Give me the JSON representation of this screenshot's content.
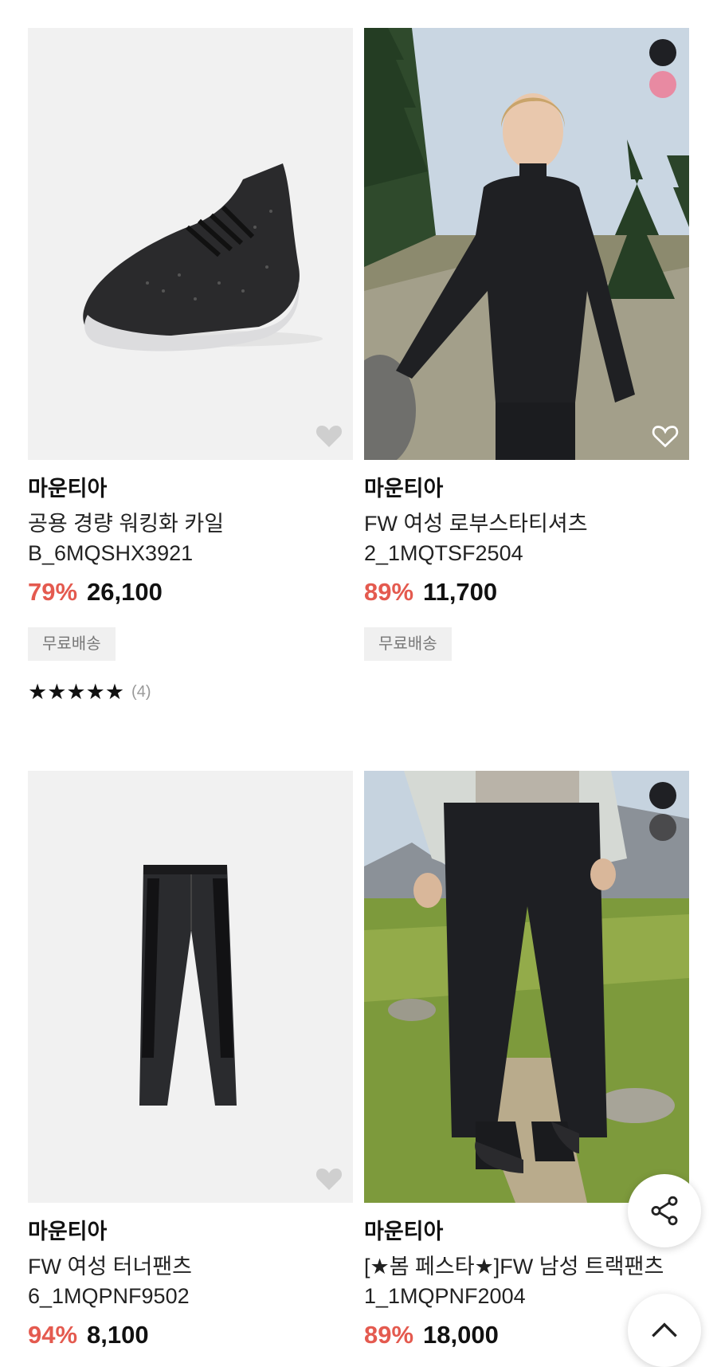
{
  "products": [
    {
      "brand": "마운티아",
      "title_line1": "공용 경량 워킹화 카일",
      "title_line2": "B_6MQSHX3921",
      "discount": "79%",
      "price": "26,100",
      "badge": "무료배송",
      "rating_stars": "★★★★★",
      "rating_count": "(4)",
      "image_icon": "sneaker-image",
      "heart_icon": "heart-icon"
    },
    {
      "brand": "마운티아",
      "title_line1": "FW 여성 로부스타티셔츠",
      "title_line2": "2_1MQTSF2504",
      "discount": "89%",
      "price": "11,700",
      "badge": "무료배송",
      "swatches": [
        "#1f2024",
        "#e88aa2"
      ],
      "image_icon": "woman-black-halfzip-photo",
      "heart_icon": "heart-outline-icon"
    },
    {
      "brand": "마운티아",
      "title_line1": "FW 여성 터너팬츠",
      "title_line2": "6_1MQPNF9502",
      "discount": "94%",
      "price": "8,100",
      "image_icon": "pants-image",
      "heart_icon": "heart-icon"
    },
    {
      "brand": "마운티아",
      "title_line1": "[★봄 페스타★]FW 남성 트랙팬츠",
      "title_line2": "1_1MQPNF2004",
      "discount": "89%",
      "price": "18,000",
      "swatches": [
        "#1f2024",
        "#4a4a4c"
      ],
      "image_icon": "man-track-pants-photo",
      "heart_icon": "heart-outline-icon"
    }
  ],
  "fabs": {
    "share_icon": "share-icon",
    "top_icon": "chevron-up-icon"
  },
  "colors": {
    "discount": "#e45a4f",
    "badge_bg": "#f0f0f0"
  }
}
